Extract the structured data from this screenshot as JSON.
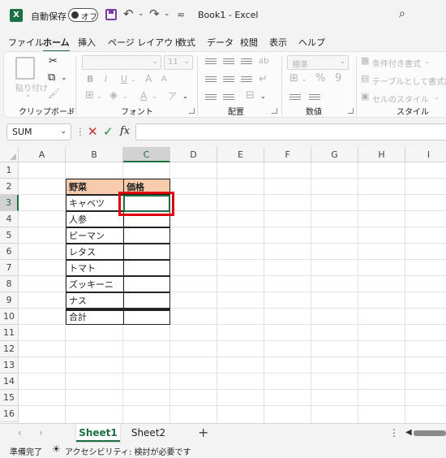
{
  "titlebar": {
    "app_badge": "X",
    "autosave_label": "自動保存",
    "autosave_state": "オフ",
    "undo_glyph": "↶",
    "redo_glyph": "↷",
    "caret": "⌄",
    "qat_more": "≂",
    "doc_title": "Book1  -  Excel",
    "search_glyph": "⌕"
  },
  "ribbon_tabs": [
    "ファイル",
    "ホーム",
    "挿入",
    "ページ レイアウト",
    "数式",
    "データ",
    "校閲",
    "表示",
    "ヘルプ"
  ],
  "active_tab": "ホーム",
  "ribbon": {
    "clipboard": {
      "label": "クリップボード",
      "paste_label": "貼り付け",
      "paste_caret": "⌄",
      "cut_glyph": "✂",
      "copy_glyph": "⧉",
      "format_painter_glyph": "🖌",
      "caret": "⌄"
    },
    "font": {
      "label": "フォント",
      "font_size": "11",
      "combo_arrow": "⌄",
      "bold": "B",
      "italic": "I",
      "underline": "U",
      "grow": "A",
      "shrink": "A",
      "border_glyph": "⊞",
      "fill_glyph": "◈",
      "color_glyph": "A",
      "phonetic": "ア",
      "caret": "⌄"
    },
    "alignment": {
      "label": "配置",
      "merge_glyph": "⊟",
      "wrap_glyph": "↵",
      "orient_glyph": "ab",
      "caret": "⌄"
    },
    "number": {
      "label": "数値",
      "format_value": "標準",
      "percent": "%",
      "comma": "9",
      "currency_glyph": "⊞",
      "caret": "⌄"
    },
    "styles": {
      "label": "スタイル",
      "conditional": "条件付き書式",
      "table": "テーブルとして書式設定",
      "cell": "セルのスタイル",
      "caret": "⌄"
    }
  },
  "formulabar": {
    "namebox": "SUM",
    "caret": "⌄",
    "dots": "⋮",
    "cancel_glyph": "✕",
    "enter_glyph": "✓",
    "fx": "fx",
    "formula": ""
  },
  "columns": [
    "A",
    "B",
    "C",
    "D",
    "E",
    "F",
    "G",
    "H",
    "I"
  ],
  "selected_column": "C",
  "rows": [
    "1",
    "2",
    "3",
    "4",
    "5",
    "6",
    "7",
    "8",
    "9",
    "10",
    "11",
    "12",
    "13",
    "14",
    "15",
    "16"
  ],
  "selected_row": "3",
  "table": {
    "header_item": "野菜",
    "header_price": "価格",
    "items": [
      "キャベツ",
      "人参",
      "ピーマン",
      "レタス",
      "トマト",
      "ズッキーニ",
      "ナス"
    ],
    "total_label": "合計",
    "header_fill": "#f8cbad"
  },
  "active_cell": "C3",
  "highlight_color": "#e0000b",
  "sheets": [
    "Sheet1",
    "Sheet2"
  ],
  "active_sheet": "Sheet1",
  "sheet_nav": {
    "prev": "‹",
    "next": "›",
    "add": "+",
    "more": "⋮",
    "scroll_left": "◀"
  },
  "status": {
    "ready": "準備完了",
    "accessibility_glyph": "☀",
    "accessibility": "アクセシビリティ: 検討が必要です"
  },
  "accent_color": "#1d6f42"
}
